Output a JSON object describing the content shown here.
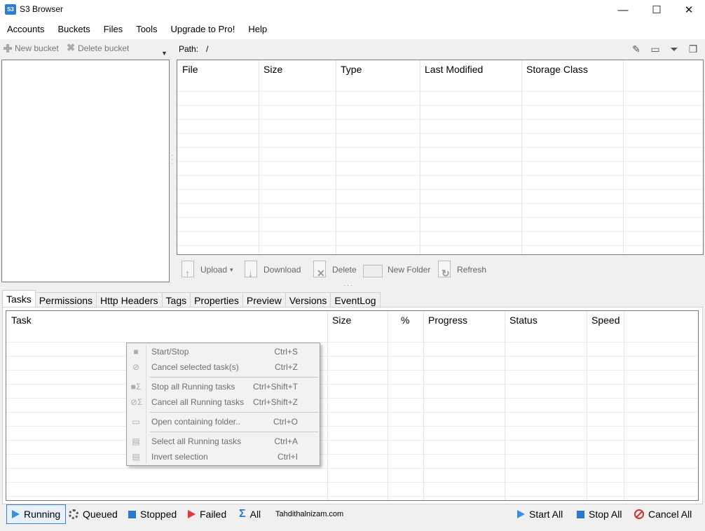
{
  "window": {
    "title": "S3 Browser",
    "icon_text": "S3",
    "minimize": "—",
    "maximize": "☐",
    "close": "✕"
  },
  "menu": [
    "Accounts",
    "Buckets",
    "Files",
    "Tools",
    "Upgrade to Pro!",
    "Help"
  ],
  "left_toolbar": {
    "new_bucket": "New bucket",
    "delete_bucket": "Delete bucket"
  },
  "path": {
    "label": "Path:",
    "value": "/"
  },
  "file_columns": [
    "File",
    "Size",
    "Type",
    "Last Modified",
    "Storage Class"
  ],
  "actions": {
    "upload": "Upload",
    "upload_caret": "▾",
    "download": "Download",
    "delete": "Delete",
    "new_folder": "New Folder",
    "refresh": "Refresh"
  },
  "tabs": [
    "Tasks",
    "Permissions",
    "Http Headers",
    "Tags",
    "Properties",
    "Preview",
    "Versions",
    "EventLog"
  ],
  "task_columns": [
    "Task",
    "Size",
    "%",
    "Progress",
    "Status",
    "Speed"
  ],
  "context_menu": [
    {
      "label": "Start/Stop",
      "shortcut": "Ctrl+S"
    },
    {
      "label": "Cancel selected task(s)",
      "shortcut": "Ctrl+Z"
    },
    {
      "label": "Stop all Running tasks",
      "shortcut": "Ctrl+Shift+T"
    },
    {
      "label": "Cancel all Running tasks",
      "shortcut": "Ctrl+Shift+Z"
    },
    {
      "label": "Open containing folder..",
      "shortcut": "Ctrl+O"
    },
    {
      "label": "Select all Running tasks",
      "shortcut": "Ctrl+A"
    },
    {
      "label": "Invert selection",
      "shortcut": "Ctrl+I"
    }
  ],
  "status_filters": {
    "running": "Running",
    "queued": "Queued",
    "stopped": "Stopped",
    "failed": "Failed",
    "all": "All"
  },
  "watermark": "Tahdithalnizam.com",
  "task_controls": {
    "start_all": "Start All",
    "stop_all": "Stop All",
    "cancel_all": "Cancel All"
  }
}
